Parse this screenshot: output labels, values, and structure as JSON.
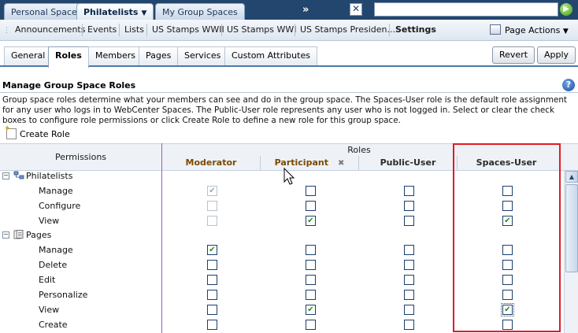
{
  "top_tabs": [
    {
      "label": "Personal Space",
      "active": false
    },
    {
      "label": "Philatelists",
      "active": true
    },
    {
      "label": "My Group Spaces",
      "active": false
    }
  ],
  "top_more": "»",
  "top_close": "✕",
  "search": {
    "value": ""
  },
  "page_nav": {
    "items": [
      "Announcements",
      "Events",
      "Lists",
      "US Stamps WWII",
      "US Stamps WWI",
      "US Stamps Presiden...",
      "Settings"
    ],
    "page_actions": "Page Actions"
  },
  "sub_tabs": [
    "General",
    "Roles",
    "Members",
    "Pages",
    "Services",
    "Custom Attributes"
  ],
  "buttons": {
    "revert": "Revert",
    "apply": "Apply"
  },
  "section": {
    "title": "Manage Group Space Roles",
    "help": "?",
    "description": "Group space roles determine what your members can see and do in the group space. The Spaces-User role is the default role assignment for any user who logs in to WebCenter Spaces. The Public-User role represents any user who is not logged in. Select or clear the check boxes to configure role permissions or click Create Role to define a new role for this group space.",
    "create_role": "Create Role"
  },
  "grid": {
    "permissions_header": "Permissions",
    "roles_header": "Roles",
    "columns": [
      "Moderator",
      "Participant",
      "Public-User",
      "Spaces-User"
    ],
    "groups": [
      {
        "name": "Philatelists",
        "icon": "group-space-icon",
        "rows": [
          {
            "label": "Manage",
            "checks": [
              true,
              false,
              false,
              false
            ],
            "disabled": [
              true,
              false,
              false,
              false
            ]
          },
          {
            "label": "Configure",
            "checks": [
              false,
              false,
              false,
              false
            ],
            "disabled": [
              true,
              false,
              false,
              false
            ]
          },
          {
            "label": "View",
            "checks": [
              false,
              true,
              false,
              true
            ],
            "disabled": [
              true,
              false,
              false,
              false
            ]
          }
        ]
      },
      {
        "name": "Pages",
        "icon": "pages-icon",
        "rows": [
          {
            "label": "Manage",
            "checks": [
              true,
              false,
              false,
              false
            ],
            "disabled": [
              false,
              false,
              false,
              false
            ]
          },
          {
            "label": "Delete",
            "checks": [
              false,
              false,
              false,
              false
            ],
            "disabled": [
              false,
              false,
              false,
              false
            ]
          },
          {
            "label": "Edit",
            "checks": [
              false,
              false,
              false,
              false
            ],
            "disabled": [
              false,
              false,
              false,
              false
            ]
          },
          {
            "label": "Personalize",
            "checks": [
              false,
              false,
              false,
              false
            ],
            "disabled": [
              false,
              false,
              false,
              false
            ]
          },
          {
            "label": "View",
            "checks": [
              false,
              true,
              false,
              true
            ],
            "disabled": [
              false,
              false,
              false,
              false
            ]
          },
          {
            "label": "Create",
            "checks": [
              false,
              false,
              false,
              false
            ],
            "disabled": [
              false,
              false,
              false,
              false
            ]
          }
        ]
      }
    ]
  },
  "colors": {
    "highlight": "#e01b24",
    "check": "#1f8f1f",
    "header_bg": "#23466f"
  }
}
